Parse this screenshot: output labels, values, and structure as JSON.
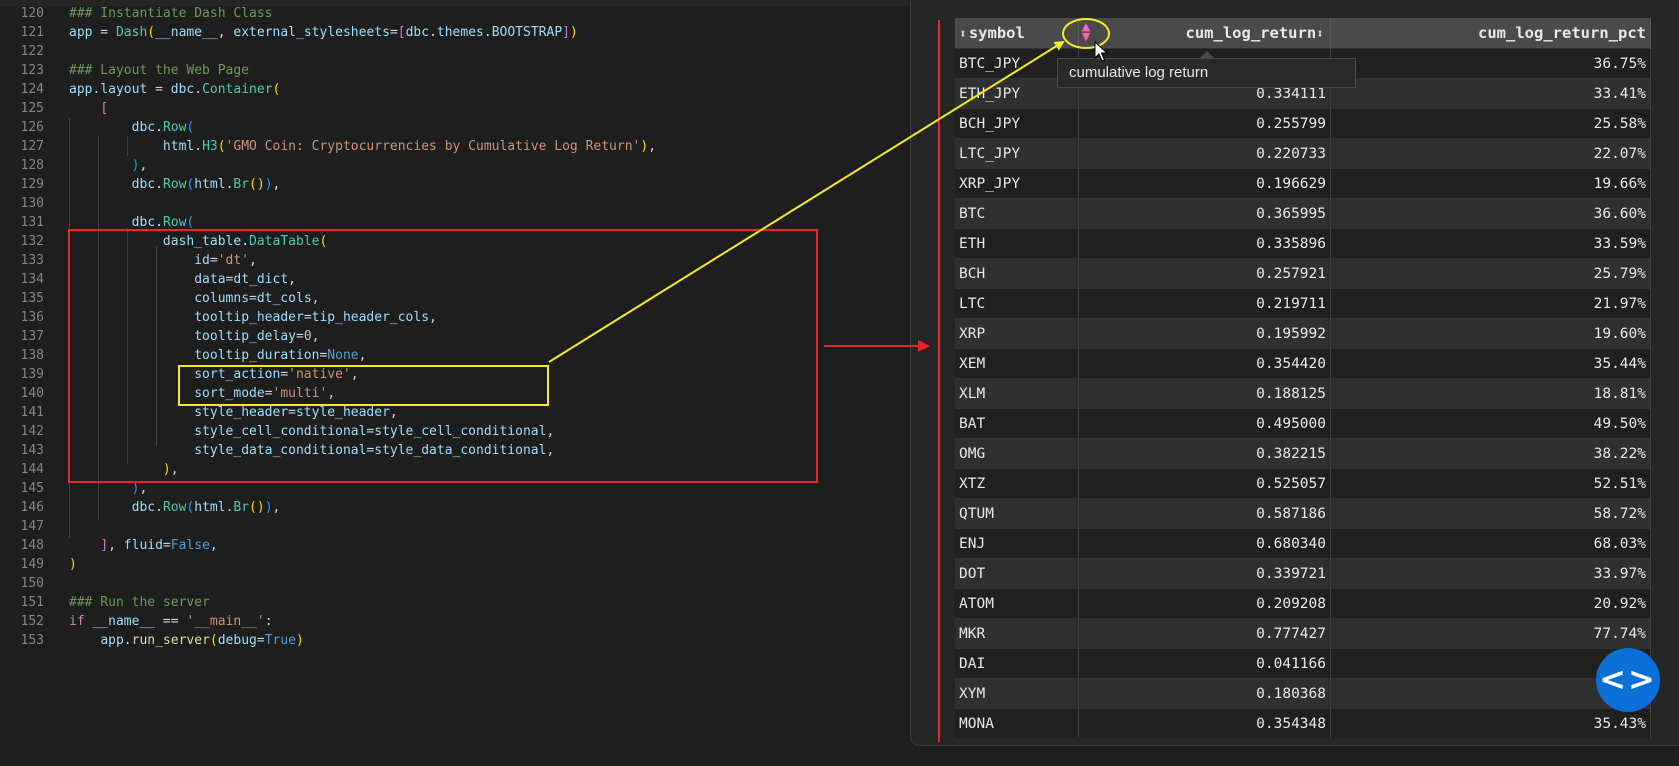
{
  "editor": {
    "lines": [
      {
        "n": "120",
        "tokens": [
          {
            "t": "### Instantiate Dash Class",
            "c": "com"
          }
        ]
      },
      {
        "n": "121",
        "tokens": [
          {
            "t": "app",
            "c": "var"
          },
          {
            "t": " = ",
            "c": "p"
          },
          {
            "t": "Dash",
            "c": "cls"
          },
          {
            "t": "(",
            "c": "b1"
          },
          {
            "t": "__name__",
            "c": "var"
          },
          {
            "t": ", ",
            "c": "p"
          },
          {
            "t": "external_stylesheets",
            "c": "var"
          },
          {
            "t": "=",
            "c": "p"
          },
          {
            "t": "[",
            "c": "b2"
          },
          {
            "t": "dbc",
            "c": "var"
          },
          {
            "t": ".",
            "c": "p"
          },
          {
            "t": "themes",
            "c": "var"
          },
          {
            "t": ".",
            "c": "p"
          },
          {
            "t": "BOOTSTRAP",
            "c": "var"
          },
          {
            "t": "]",
            "c": "b2"
          },
          {
            "t": ")",
            "c": "b1"
          }
        ]
      },
      {
        "n": "122",
        "tokens": []
      },
      {
        "n": "123",
        "tokens": [
          {
            "t": "### Layout the Web Page",
            "c": "com"
          }
        ]
      },
      {
        "n": "124",
        "tokens": [
          {
            "t": "app",
            "c": "var"
          },
          {
            "t": ".",
            "c": "p"
          },
          {
            "t": "layout",
            "c": "var"
          },
          {
            "t": " = ",
            "c": "p"
          },
          {
            "t": "dbc",
            "c": "var"
          },
          {
            "t": ".",
            "c": "p"
          },
          {
            "t": "Container",
            "c": "cls"
          },
          {
            "t": "(",
            "c": "b1"
          }
        ]
      },
      {
        "n": "125",
        "tokens": [
          {
            "t": "    ",
            "c": "p"
          },
          {
            "t": "[",
            "c": "b2"
          }
        ]
      },
      {
        "n": "126",
        "tokens": [
          {
            "t": "        ",
            "c": "p"
          },
          {
            "t": "dbc",
            "c": "var"
          },
          {
            "t": ".",
            "c": "p"
          },
          {
            "t": "Row",
            "c": "cls"
          },
          {
            "t": "(",
            "c": "b3"
          }
        ]
      },
      {
        "n": "127",
        "tokens": [
          {
            "t": "            ",
            "c": "p"
          },
          {
            "t": "html",
            "c": "var"
          },
          {
            "t": ".",
            "c": "p"
          },
          {
            "t": "H3",
            "c": "cls"
          },
          {
            "t": "(",
            "c": "b1"
          },
          {
            "t": "'GMO Coin: Cryptocurrencies by Cumulative Log Return'",
            "c": "str"
          },
          {
            "t": ")",
            "c": "b1"
          },
          {
            "t": ",",
            "c": "p"
          }
        ]
      },
      {
        "n": "128",
        "tokens": [
          {
            "t": "        ",
            "c": "p"
          },
          {
            "t": ")",
            "c": "b3"
          },
          {
            "t": ",",
            "c": "p"
          }
        ]
      },
      {
        "n": "129",
        "tokens": [
          {
            "t": "        ",
            "c": "p"
          },
          {
            "t": "dbc",
            "c": "var"
          },
          {
            "t": ".",
            "c": "p"
          },
          {
            "t": "Row",
            "c": "cls"
          },
          {
            "t": "(",
            "c": "b3"
          },
          {
            "t": "html",
            "c": "var"
          },
          {
            "t": ".",
            "c": "p"
          },
          {
            "t": "Br",
            "c": "cls"
          },
          {
            "t": "()",
            "c": "b1"
          },
          {
            "t": ")",
            "c": "b3"
          },
          {
            "t": ",",
            "c": "p"
          }
        ]
      },
      {
        "n": "130",
        "tokens": []
      },
      {
        "n": "131",
        "tokens": [
          {
            "t": "        ",
            "c": "p"
          },
          {
            "t": "dbc",
            "c": "var"
          },
          {
            "t": ".",
            "c": "p"
          },
          {
            "t": "Row",
            "c": "cls"
          },
          {
            "t": "(",
            "c": "b3"
          }
        ]
      },
      {
        "n": "132",
        "tokens": [
          {
            "t": "            ",
            "c": "p"
          },
          {
            "t": "dash_table",
            "c": "var"
          },
          {
            "t": ".",
            "c": "p"
          },
          {
            "t": "DataTable",
            "c": "cls"
          },
          {
            "t": "(",
            "c": "b1"
          }
        ]
      },
      {
        "n": "133",
        "tokens": [
          {
            "t": "                ",
            "c": "p"
          },
          {
            "t": "id",
            "c": "var"
          },
          {
            "t": "=",
            "c": "p"
          },
          {
            "t": "'dt'",
            "c": "str"
          },
          {
            "t": ",",
            "c": "p"
          }
        ]
      },
      {
        "n": "134",
        "tokens": [
          {
            "t": "                ",
            "c": "p"
          },
          {
            "t": "data",
            "c": "var"
          },
          {
            "t": "=",
            "c": "p"
          },
          {
            "t": "dt_dict",
            "c": "var"
          },
          {
            "t": ",",
            "c": "p"
          }
        ]
      },
      {
        "n": "135",
        "tokens": [
          {
            "t": "                ",
            "c": "p"
          },
          {
            "t": "columns",
            "c": "var"
          },
          {
            "t": "=",
            "c": "p"
          },
          {
            "t": "dt_cols",
            "c": "var"
          },
          {
            "t": ",",
            "c": "p"
          }
        ]
      },
      {
        "n": "136",
        "tokens": [
          {
            "t": "                ",
            "c": "p"
          },
          {
            "t": "tooltip_header",
            "c": "var"
          },
          {
            "t": "=",
            "c": "p"
          },
          {
            "t": "tip_header_cols",
            "c": "var"
          },
          {
            "t": ",",
            "c": "p"
          }
        ]
      },
      {
        "n": "137",
        "tokens": [
          {
            "t": "                ",
            "c": "p"
          },
          {
            "t": "tooltip_delay",
            "c": "var"
          },
          {
            "t": "=",
            "c": "p"
          },
          {
            "t": "0",
            "c": "num"
          },
          {
            "t": ",",
            "c": "p"
          }
        ]
      },
      {
        "n": "138",
        "tokens": [
          {
            "t": "                ",
            "c": "p"
          },
          {
            "t": "tooltip_duration",
            "c": "var"
          },
          {
            "t": "=",
            "c": "p"
          },
          {
            "t": "None",
            "c": "kw"
          },
          {
            "t": ",",
            "c": "p"
          }
        ]
      },
      {
        "n": "139",
        "tokens": [
          {
            "t": "                ",
            "c": "p"
          },
          {
            "t": "sort_action",
            "c": "var"
          },
          {
            "t": "=",
            "c": "p"
          },
          {
            "t": "'native'",
            "c": "str"
          },
          {
            "t": ",",
            "c": "p"
          }
        ]
      },
      {
        "n": "140",
        "tokens": [
          {
            "t": "                ",
            "c": "p"
          },
          {
            "t": "sort_mode",
            "c": "var"
          },
          {
            "t": "=",
            "c": "p"
          },
          {
            "t": "'multi'",
            "c": "str"
          },
          {
            "t": ",",
            "c": "p"
          }
        ]
      },
      {
        "n": "141",
        "tokens": [
          {
            "t": "                ",
            "c": "p"
          },
          {
            "t": "style_header",
            "c": "var"
          },
          {
            "t": "=",
            "c": "p"
          },
          {
            "t": "style_header",
            "c": "var"
          },
          {
            "t": ",",
            "c": "p"
          }
        ]
      },
      {
        "n": "142",
        "tokens": [
          {
            "t": "                ",
            "c": "p"
          },
          {
            "t": "style_cell_conditional",
            "c": "var"
          },
          {
            "t": "=",
            "c": "p"
          },
          {
            "t": "style_cell_conditional",
            "c": "var"
          },
          {
            "t": ",",
            "c": "p"
          }
        ]
      },
      {
        "n": "143",
        "tokens": [
          {
            "t": "                ",
            "c": "p"
          },
          {
            "t": "style_data_conditional",
            "c": "var"
          },
          {
            "t": "=",
            "c": "p"
          },
          {
            "t": "style_data_conditional",
            "c": "var"
          },
          {
            "t": ",",
            "c": "p"
          }
        ]
      },
      {
        "n": "144",
        "tokens": [
          {
            "t": "            ",
            "c": "p"
          },
          {
            "t": ")",
            "c": "b1"
          },
          {
            "t": ",",
            "c": "p"
          }
        ]
      },
      {
        "n": "145",
        "tokens": [
          {
            "t": "        ",
            "c": "p"
          },
          {
            "t": ")",
            "c": "b3"
          },
          {
            "t": ",",
            "c": "p"
          }
        ]
      },
      {
        "n": "146",
        "tokens": [
          {
            "t": "        ",
            "c": "p"
          },
          {
            "t": "dbc",
            "c": "var"
          },
          {
            "t": ".",
            "c": "p"
          },
          {
            "t": "Row",
            "c": "cls"
          },
          {
            "t": "(",
            "c": "b3"
          },
          {
            "t": "html",
            "c": "var"
          },
          {
            "t": ".",
            "c": "p"
          },
          {
            "t": "Br",
            "c": "cls"
          },
          {
            "t": "()",
            "c": "b1"
          },
          {
            "t": ")",
            "c": "b3"
          },
          {
            "t": ",",
            "c": "p"
          }
        ]
      },
      {
        "n": "147",
        "tokens": []
      },
      {
        "n": "148",
        "tokens": [
          {
            "t": "    ",
            "c": "p"
          },
          {
            "t": "]",
            "c": "b2"
          },
          {
            "t": ", ",
            "c": "p"
          },
          {
            "t": "fluid",
            "c": "var"
          },
          {
            "t": "=",
            "c": "p"
          },
          {
            "t": "False",
            "c": "kw"
          },
          {
            "t": ",",
            "c": "p"
          }
        ]
      },
      {
        "n": "149",
        "tokens": [
          {
            "t": ")",
            "c": "b1"
          }
        ]
      },
      {
        "n": "150",
        "tokens": []
      },
      {
        "n": "151",
        "tokens": [
          {
            "t": "### Run the server",
            "c": "com"
          }
        ]
      },
      {
        "n": "152",
        "tokens": [
          {
            "t": "if",
            "c": "ctl"
          },
          {
            "t": " ",
            "c": "p"
          },
          {
            "t": "__name__",
            "c": "var"
          },
          {
            "t": " == ",
            "c": "p"
          },
          {
            "t": "'__main__'",
            "c": "str"
          },
          {
            "t": ":",
            "c": "p"
          }
        ]
      },
      {
        "n": "153",
        "tokens": [
          {
            "t": "    ",
            "c": "p"
          },
          {
            "t": "app",
            "c": "var"
          },
          {
            "t": ".",
            "c": "p"
          },
          {
            "t": "run_server",
            "c": "fn"
          },
          {
            "t": "(",
            "c": "b1"
          },
          {
            "t": "debug",
            "c": "var"
          },
          {
            "t": "=",
            "c": "p"
          },
          {
            "t": "True",
            "c": "kw"
          },
          {
            "t": ")",
            "c": "b1"
          }
        ]
      }
    ]
  },
  "table": {
    "sort_glyph": "⬍",
    "columns": [
      "symbol",
      "cum_log_return",
      "cum_log_return_pct"
    ],
    "rows": [
      [
        "BTC_JPY",
        "",
        "36.75%"
      ],
      [
        "ETH_JPY",
        "0.334111",
        "33.41%"
      ],
      [
        "BCH_JPY",
        "0.255799",
        "25.58%"
      ],
      [
        "LTC_JPY",
        "0.220733",
        "22.07%"
      ],
      [
        "XRP_JPY",
        "0.196629",
        "19.66%"
      ],
      [
        "BTC",
        "0.365995",
        "36.60%"
      ],
      [
        "ETH",
        "0.335896",
        "33.59%"
      ],
      [
        "BCH",
        "0.257921",
        "25.79%"
      ],
      [
        "LTC",
        "0.219711",
        "21.97%"
      ],
      [
        "XRP",
        "0.195992",
        "19.60%"
      ],
      [
        "XEM",
        "0.354420",
        "35.44%"
      ],
      [
        "XLM",
        "0.188125",
        "18.81%"
      ],
      [
        "BAT",
        "0.495000",
        "49.50%"
      ],
      [
        "OMG",
        "0.382215",
        "38.22%"
      ],
      [
        "XTZ",
        "0.525057",
        "52.51%"
      ],
      [
        "QTUM",
        "0.587186",
        "58.72%"
      ],
      [
        "ENJ",
        "0.680340",
        "68.03%"
      ],
      [
        "DOT",
        "0.339721",
        "33.97%"
      ],
      [
        "ATOM",
        "0.209208",
        "20.92%"
      ],
      [
        "MKR",
        "0.777427",
        "77.74%"
      ],
      [
        "DAI",
        "0.041166",
        ""
      ],
      [
        "XYM",
        "0.180368",
        ""
      ],
      [
        "MONA",
        "0.354348",
        "35.43%"
      ]
    ]
  },
  "tooltip": {
    "text": "cumulative log return"
  },
  "fab": {
    "label": "<>",
    "icon": "code-icon"
  },
  "colors": {
    "highlight_red": "#e8262a",
    "highlight_yellow": "#f3ea24",
    "sort_active": "#ff5fb7",
    "fab": "#0a6fd6"
  }
}
